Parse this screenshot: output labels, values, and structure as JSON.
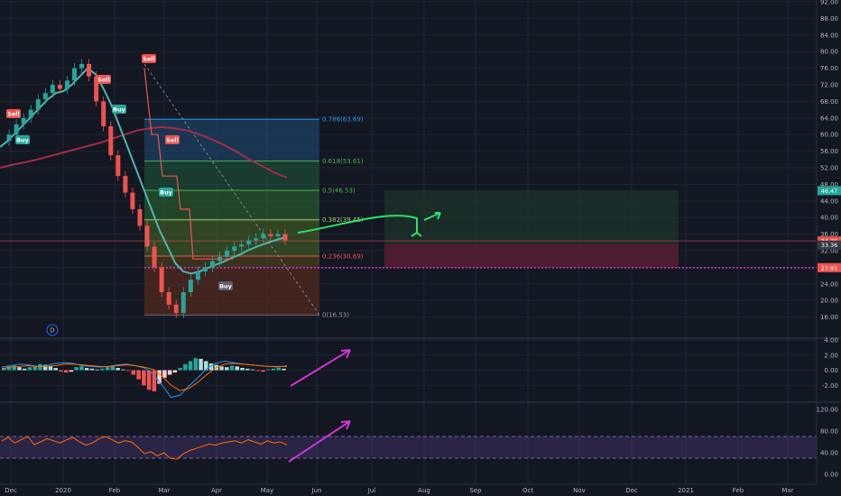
{
  "colors": {
    "background": "#131722",
    "grid": "#1f2433",
    "text": "#b2b5be",
    "price_up": "#26a69a",
    "price_down": "#ef5350",
    "ema_fast": "#4db6ac",
    "ema_slow": "#a32b47",
    "arrow_green": "#2ee06a",
    "arrow_magenta": "#d633d6",
    "entry_line": "#d633d6"
  },
  "chart_data": [
    {
      "type": "candlestick",
      "title": "",
      "x": [
        "Dec",
        "2020",
        "Feb",
        "Mar",
        "Apr",
        "May",
        "Jun",
        "Jul",
        "Aug",
        "Sep",
        "Oct",
        "Nov",
        "Dec",
        "2021",
        "Feb",
        "Mar"
      ],
      "ylim": [
        12,
        92
      ],
      "y_ticks": [
        "92.00",
        "88.00",
        "84.00",
        "80.00",
        "76.00",
        "72.00",
        "68.00",
        "64.00",
        "60.00",
        "56.00",
        "52.00",
        "48.00",
        "44.00",
        "40.00",
        "36.00",
        "32.00",
        "28.00",
        "24.00",
        "20.00",
        "16.00"
      ],
      "price_close": [
        58.5,
        60,
        62.5,
        64,
        66,
        68.5,
        70,
        72,
        71,
        73,
        76,
        77,
        74,
        68,
        62,
        55,
        50,
        46,
        42,
        38,
        33,
        28,
        22,
        19,
        17,
        22,
        25,
        27,
        28,
        29.5,
        30.5,
        32,
        33,
        33.5,
        34.5,
        35,
        36,
        35.5,
        36,
        34.5
      ],
      "series": [
        {
          "name": "",
          "color": "#4db6ac",
          "values": [
            57,
            58.5,
            60.5,
            62.5,
            64.5,
            66.5,
            68.5,
            70,
            70.5,
            72,
            74,
            76,
            74.5,
            71,
            67,
            62,
            57,
            52,
            47,
            42,
            37,
            33,
            29,
            27,
            26.5,
            27,
            27.8,
            28.6,
            29.3,
            30.2,
            31,
            32,
            32.8,
            33.5,
            34.2,
            34.8,
            35.3
          ]
        },
        {
          "name": "",
          "color": "#a32b47",
          "values": [
            52,
            52.7,
            53.3,
            54,
            54.8,
            55.6,
            56.4,
            57.2,
            58,
            59,
            60,
            61,
            61.5,
            61.8,
            61.5,
            61,
            60,
            58.8,
            57.4,
            55.8,
            54,
            52.4,
            50.8,
            49.6
          ]
        }
      ],
      "signals": [
        {
          "label": "Sell",
          "color": "#ef5350"
        },
        {
          "label": "Buy",
          "color": "#26a69a"
        },
        {
          "label": "Sell",
          "color": "#ef5350"
        },
        {
          "label": "Buy",
          "color": "#26a69a"
        },
        {
          "label": "Sell",
          "color": "#ef5350"
        },
        {
          "label": "Sell",
          "color": "#ef5350"
        },
        {
          "label": "Buy",
          "color": "#26a69a"
        },
        {
          "label": "Buy",
          "color": "#5d606b"
        }
      ],
      "fibonacci": [
        {
          "label": "0.786(63.69)",
          "value": 63.69,
          "color": "#2196f3"
        },
        {
          "label": "0.618(53.61)",
          "value": 53.61,
          "color": "#4caf50"
        },
        {
          "label": "0.5(46.53)",
          "value": 46.53,
          "color": "#4caf50"
        },
        {
          "label": "0.382(39.45)",
          "value": 39.45,
          "color": "#9ccc65"
        },
        {
          "label": "0.236(30.69)",
          "value": 30.69,
          "color": "#ef5350"
        },
        {
          "label": "0(16.53)",
          "value": 16.53,
          "color": "#9598a1"
        }
      ],
      "position": {
        "target": 46.53,
        "entry": 33.7,
        "stop": 27.9
      },
      "price_labels": [
        {
          "text": "46.47",
          "value": 46.47,
          "color": "#26a69a"
        },
        {
          "text": "34.36",
          "value": 34.36,
          "color": "#ef5350"
        },
        {
          "text": "33.36",
          "value": 33.36,
          "color": "#363a45"
        },
        {
          "text": "27.91",
          "value": 27.91,
          "color": "#ef5350"
        }
      ],
      "event_marker": "D"
    },
    {
      "type": "bar",
      "title": "",
      "ylim": [
        -4,
        4
      ],
      "y_ticks": [
        "4.00",
        "2.00",
        "0.00",
        "-2.00"
      ],
      "histogram": [
        0.3,
        0.5,
        0.6,
        0.4,
        0.2,
        0.4,
        0.6,
        0.8,
        0.7,
        0.5,
        0.3,
        -0.2,
        -0.3,
        -0.2,
        0.4,
        0.5,
        0.3,
        0.2,
        0.1,
        0.2,
        0.4,
        0.5,
        0.3,
        0.1,
        -0.1,
        -0.6,
        -1.2,
        -2.0,
        -2.6,
        -2.8,
        -1.8,
        -1.0,
        -0.6,
        -0.3,
        0.3,
        0.8,
        1.2,
        1.6,
        1.5,
        1.2,
        0.9,
        0.7,
        0.5,
        0.4,
        0.6,
        0.5,
        0.3,
        0.2,
        0.1,
        -0.1,
        -0.2,
        0.1,
        0.2,
        0.3,
        0.2
      ],
      "series": [
        {
          "name": "",
          "color": "#2196f3",
          "values": [
            0.4,
            0.6,
            0.8,
            0.7,
            0.5,
            0.6,
            0.9,
            1.0,
            0.9,
            0.6,
            0.5,
            0.4,
            0.5,
            0.7,
            0.8,
            0.6,
            0.3,
            -0.5,
            -2.0,
            -3.6,
            -3.3,
            -2.1,
            -1.0,
            0.2,
            0.9,
            1.2,
            1.0,
            0.8,
            0.7,
            0.6,
            0.5,
            0.4,
            0.6
          ]
        },
        {
          "name": "",
          "color": "#ff6d00",
          "values": [
            0.2,
            0.4,
            0.5,
            0.6,
            0.5,
            0.5,
            0.6,
            0.8,
            0.8,
            0.7,
            0.6,
            0.5,
            0.5,
            0.6,
            0.7,
            0.6,
            0.4,
            0.1,
            -0.8,
            -2.0,
            -2.7,
            -2.4,
            -1.6,
            -0.6,
            0.3,
            0.8,
            0.9,
            0.8,
            0.7,
            0.6,
            0.5,
            0.5,
            0.5
          ]
        }
      ]
    },
    {
      "type": "line",
      "title": "",
      "ylim": [
        -10,
        130
      ],
      "y_ticks": [
        "120.00",
        "80.00",
        "40.00",
        "0.00"
      ],
      "band": [
        30,
        70
      ],
      "series": [
        {
          "name": "",
          "color": "#ff6d00",
          "values": [
            62,
            68,
            58,
            64,
            70,
            55,
            60,
            66,
            62,
            58,
            64,
            68,
            60,
            54,
            58,
            66,
            70,
            64,
            58,
            62,
            60,
            50,
            38,
            42,
            34,
            40,
            30,
            28,
            38,
            44,
            48,
            52,
            56,
            54,
            58,
            60,
            62,
            58,
            64,
            60,
            56,
            62,
            58,
            60,
            54
          ]
        }
      ]
    }
  ],
  "time_axis": [
    "Dec",
    "2020",
    "Feb",
    "Mar",
    "Apr",
    "May",
    "Jun",
    "Jul",
    "Aug",
    "Sep",
    "Oct",
    "Nov",
    "Dec",
    "2021",
    "Feb",
    "Mar"
  ]
}
